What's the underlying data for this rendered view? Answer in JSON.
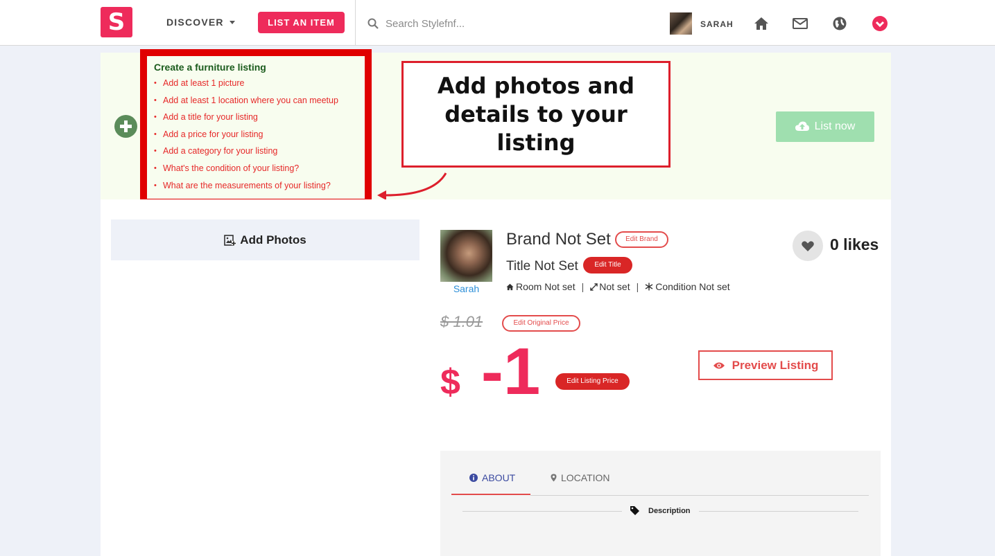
{
  "header": {
    "logo_letter": "S",
    "discover_label": "DISCOVER",
    "list_item_label": "LIST AN ITEM",
    "search_placeholder": "Search Stylefnf...",
    "username": "SARAH"
  },
  "banner": {
    "checklist_title": "Create a furniture listing",
    "checklist_items": [
      "Add at least 1 picture",
      "Add at least 1 location where you can meetup",
      "Add a title for your listing",
      "Add a price for your listing",
      "Add a category for your listing",
      "What's the condition of your listing?",
      "What are the measurements of your listing?"
    ],
    "callout_text": "Add photos and details to your listing",
    "list_now_label": "List now"
  },
  "listing": {
    "add_photos_label": "Add Photos",
    "seller_name": "Sarah",
    "brand": "Brand Not Set",
    "edit_brand_label": "Edit Brand",
    "title": "Title Not Set",
    "edit_title_label": "Edit Title",
    "room": "Room Not set",
    "size": "Not set",
    "condition": "Condition Not set",
    "likes": "0 likes",
    "original_price": "$  1.01",
    "edit_original_price_label": "Edit Original Price",
    "price_currency": "$",
    "price_amount": "-1",
    "edit_listing_price_label": "Edit Listing Price",
    "preview_label": "Preview Listing"
  },
  "tabs": {
    "about_label": "ABOUT",
    "location_label": "LOCATION",
    "description_label": "Description"
  },
  "colors": {
    "brand_pink": "#ee2b5b",
    "callout_red": "#e00000",
    "checklist_green": "#1a5b1c",
    "list_now_green": "#9fdfaf"
  }
}
